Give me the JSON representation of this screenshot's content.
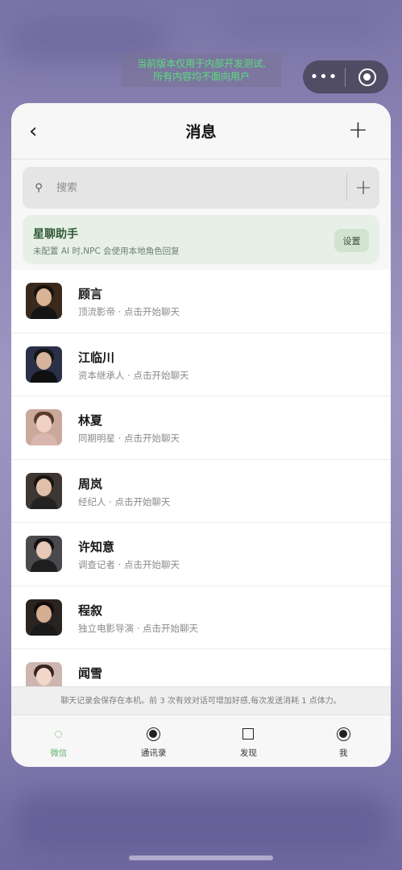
{
  "dev_notice": {
    "line1": "当前版本仅用于内部开发测试,",
    "line2": "所有内容均不面向用户"
  },
  "capsule": {
    "more_icon": "more-dots-icon",
    "close_icon": "target-close-icon"
  },
  "nav": {
    "back": "‹",
    "title": "消息",
    "add": "+"
  },
  "search": {
    "placeholder": "搜索",
    "add": "+"
  },
  "assistant": {
    "title": "星聊助手",
    "desc": "未配置 AI 时,NPC 会使用本地角色回复",
    "button": "设置"
  },
  "contacts": [
    {
      "name": "顾言",
      "subtitle": "顶流影帝 · 点击开始聊天"
    },
    {
      "name": "江临川",
      "subtitle": "资本继承人 · 点击开始聊天"
    },
    {
      "name": "林夏",
      "subtitle": "同期明星 · 点击开始聊天"
    },
    {
      "name": "周岚",
      "subtitle": "经纪人 · 点击开始聊天"
    },
    {
      "name": "许知意",
      "subtitle": "调查记者 · 点击开始聊天"
    },
    {
      "name": "程叙",
      "subtitle": "独立电影导演 · 点击开始聊天"
    },
    {
      "name": "闻雪",
      "subtitle": ""
    }
  ],
  "footer_note": "聊天记录会保存在本机。前 3 次有效对话可增加好感,每次发送消耗 1 点体力。",
  "tabs": [
    {
      "label": "微信",
      "icon": "loading-dot-icon"
    },
    {
      "label": "通讯录",
      "icon": "target-icon"
    },
    {
      "label": "发现",
      "icon": "square-icon"
    },
    {
      "label": "我",
      "icon": "target-icon"
    }
  ]
}
